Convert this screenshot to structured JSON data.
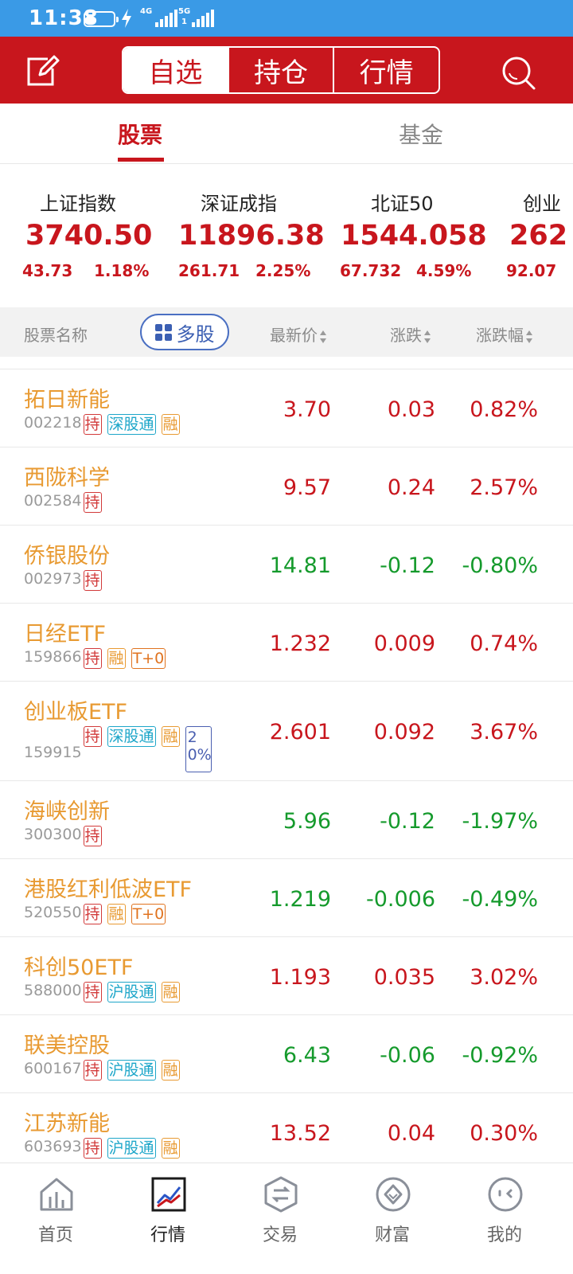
{
  "status_bar": {
    "time": "11:38",
    "net1": "4G",
    "net2": "5G",
    "net2_sub": "1"
  },
  "header": {
    "segments": [
      "自选",
      "持仓",
      "行情"
    ],
    "active_segment": 0
  },
  "subtabs": {
    "stock": "股票",
    "fund": "基金"
  },
  "indices": [
    {
      "name": "上证指数",
      "value": "3740.50",
      "change": "43.73",
      "pct": "1.18%"
    },
    {
      "name": "深证成指",
      "value": "11896.38",
      "change": "261.71",
      "pct": "2.25%"
    },
    {
      "name": "北证50",
      "value": "1544.058",
      "change": "67.732",
      "pct": "4.59%"
    },
    {
      "name": "创业",
      "value": "262",
      "change": "92.07",
      "pct": ""
    }
  ],
  "columns": {
    "name": "股票名称",
    "multi": "多股",
    "price": "最新价",
    "change": "涨跌",
    "pct": "涨跌幅"
  },
  "stocks": [
    {
      "name": "拓日新能",
      "code": "002218",
      "tags": [
        "持",
        "深股通",
        "融"
      ],
      "price": "3.70",
      "change": "0.03",
      "pct": "0.82%",
      "trend": "up"
    },
    {
      "name": "西陇科学",
      "code": "002584",
      "tags": [
        "持"
      ],
      "price": "9.57",
      "change": "0.24",
      "pct": "2.57%",
      "trend": "up"
    },
    {
      "name": "侨银股份",
      "code": "002973",
      "tags": [
        "持"
      ],
      "price": "14.81",
      "change": "-0.12",
      "pct": "-0.80%",
      "trend": "down"
    },
    {
      "name": "日经ETF",
      "code": "159866",
      "tags": [
        "持",
        "融",
        "T+0"
      ],
      "price": "1.232",
      "change": "0.009",
      "pct": "0.74%",
      "trend": "up"
    },
    {
      "name": "创业板ETF",
      "code": "159915",
      "tags": [
        "持",
        "深股通",
        "融",
        "20%"
      ],
      "price": "2.601",
      "change": "0.092",
      "pct": "3.67%",
      "trend": "up"
    },
    {
      "name": "海峡创新",
      "code": "300300",
      "tags": [
        "持"
      ],
      "price": "5.96",
      "change": "-0.12",
      "pct": "-1.97%",
      "trend": "down"
    },
    {
      "name": "港股红利低波ETF",
      "code": "520550",
      "tags": [
        "持",
        "融",
        "T+0"
      ],
      "price": "1.219",
      "change": "-0.006",
      "pct": "-0.49%",
      "trend": "down"
    },
    {
      "name": "科创50ETF",
      "code": "588000",
      "tags": [
        "持",
        "沪股通",
        "融"
      ],
      "price": "1.193",
      "change": "0.035",
      "pct": "3.02%",
      "trend": "up"
    },
    {
      "name": "联美控股",
      "code": "600167",
      "tags": [
        "持",
        "沪股通",
        "融"
      ],
      "price": "6.43",
      "change": "-0.06",
      "pct": "-0.92%",
      "trend": "down"
    },
    {
      "name": "江苏新能",
      "code": "603693",
      "tags": [
        "持",
        "沪股通",
        "融"
      ],
      "price": "13.52",
      "change": "0.04",
      "pct": "0.30%",
      "trend": "up"
    }
  ],
  "bottom_nav": [
    {
      "label": "首页",
      "icon": "home-chart-icon"
    },
    {
      "label": "行情",
      "icon": "market-trend-icon"
    },
    {
      "label": "交易",
      "icon": "trade-exchange-icon"
    },
    {
      "label": "财富",
      "icon": "wealth-diamond-icon"
    },
    {
      "label": "我的",
      "icon": "profile-face-icon"
    }
  ],
  "active_nav": 1,
  "colors": {
    "brand_red": "#c8161d",
    "up": "#c8161d",
    "down": "#159a2c",
    "stock_name": "#e89a32",
    "status_bar": "#3a9ae6"
  }
}
